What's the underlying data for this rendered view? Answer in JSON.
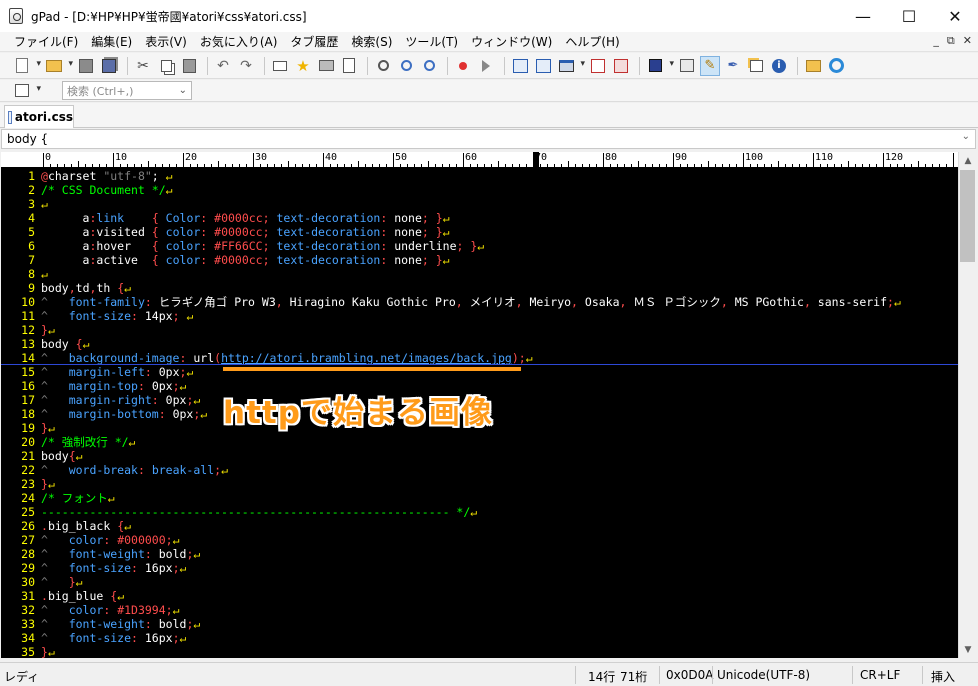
{
  "window": {
    "title": "gPad - [D:¥HP¥HP¥蛍帝國¥atori¥css¥atori.css]",
    "controls": [
      "—",
      "☐",
      "✕"
    ]
  },
  "menu": {
    "items": [
      "ファイル(F)",
      "編集(E)",
      "表示(V)",
      "お気に入り(A)",
      "タブ履歴",
      "検索(S)",
      "ツール(T)",
      "ウィンドウ(W)",
      "ヘルプ(H)"
    ],
    "mdi_controls": [
      "_",
      "⧉",
      "✕"
    ]
  },
  "toolbar": {
    "icons": [
      "new-file-icon",
      "open-folder-icon",
      "save-icon",
      "save-all-icon",
      "cut-icon",
      "copy-icon",
      "paste-icon",
      "undo-icon",
      "redo-icon",
      "folder-icon",
      "favorite-star-icon",
      "print-icon",
      "page-icon",
      "find-icon",
      "find-next-icon",
      "find-prev-icon",
      "record-macro-icon",
      "play-macro-icon",
      "ruler-icon",
      "grid-icon",
      "window-icon",
      "list-icon",
      "list-red-icon",
      "color-icon",
      "config-icon",
      "edit-pen-icon",
      "pin-icon",
      "new-window-icon",
      "info-icon",
      "folder-open-icon",
      "browser-icon"
    ]
  },
  "search": {
    "placeholder": "検索 (Ctrl+,)"
  },
  "tab": {
    "label": "atori.css"
  },
  "function_bar": {
    "value": "body {"
  },
  "ruler": {
    "labels": [
      "0",
      "10",
      "20",
      "30",
      "40",
      "50",
      "60",
      "70",
      "80",
      "90",
      "100",
      "110",
      "120"
    ]
  },
  "editor": {
    "current_line": 14,
    "lines": [
      [
        [
          "c-at",
          "@"
        ],
        [
          "",
          "charset "
        ],
        [
          "c-str",
          "\"utf-8\""
        ],
        [
          "",
          "; "
        ],
        [
          "c-eol",
          "↵"
        ]
      ],
      [
        [
          "c-cmt",
          "/* CSS Document */"
        ],
        [
          "c-eol",
          "↵"
        ]
      ],
      [
        [
          "c-eol",
          "↵"
        ]
      ],
      [
        [
          "",
          "      a"
        ],
        [
          "c-red",
          ":"
        ],
        [
          "c-prop",
          "link"
        ],
        [
          "",
          "    "
        ],
        [
          "c-red",
          "{ "
        ],
        [
          "c-prop",
          "Color"
        ],
        [
          "c-red",
          ": "
        ],
        [
          "c-red",
          "#0000cc"
        ],
        [
          "c-red",
          "; "
        ],
        [
          "c-prop",
          "text-decoration"
        ],
        [
          "c-red",
          ": "
        ],
        [
          "",
          "none"
        ],
        [
          "c-red",
          "; }"
        ],
        [
          "c-eol",
          "↵"
        ]
      ],
      [
        [
          "",
          "      a"
        ],
        [
          "c-red",
          ":"
        ],
        [
          "",
          "visited "
        ],
        [
          "c-red",
          "{ "
        ],
        [
          "c-prop",
          "color"
        ],
        [
          "c-red",
          ": "
        ],
        [
          "c-red",
          "#0000cc"
        ],
        [
          "c-red",
          "; "
        ],
        [
          "c-prop",
          "text-decoration"
        ],
        [
          "c-red",
          ": "
        ],
        [
          "",
          "none"
        ],
        [
          "c-red",
          "; }"
        ],
        [
          "c-eol",
          "↵"
        ]
      ],
      [
        [
          "",
          "      a"
        ],
        [
          "c-red",
          ":"
        ],
        [
          "",
          "hover   "
        ],
        [
          "c-red",
          "{ "
        ],
        [
          "c-prop",
          "color"
        ],
        [
          "c-red",
          ": "
        ],
        [
          "c-red",
          "#FF66CC"
        ],
        [
          "c-red",
          "; "
        ],
        [
          "c-prop",
          "text-decoration"
        ],
        [
          "c-red",
          ": "
        ],
        [
          "",
          "underline"
        ],
        [
          "c-red",
          "; }"
        ],
        [
          "c-eol",
          "↵"
        ]
      ],
      [
        [
          "",
          "      a"
        ],
        [
          "c-red",
          ":"
        ],
        [
          "",
          "active  "
        ],
        [
          "c-red",
          "{ "
        ],
        [
          "c-prop",
          "color"
        ],
        [
          "c-red",
          ": "
        ],
        [
          "c-red",
          "#0000cc"
        ],
        [
          "c-red",
          "; "
        ],
        [
          "c-prop",
          "text-decoration"
        ],
        [
          "c-red",
          ": "
        ],
        [
          "",
          "none"
        ],
        [
          "c-red",
          "; }"
        ],
        [
          "c-eol",
          "↵"
        ]
      ],
      [
        [
          "c-eol",
          "↵"
        ]
      ],
      [
        [
          "",
          "body"
        ],
        [
          "c-red",
          ","
        ],
        [
          "",
          "td"
        ],
        [
          "c-red",
          ","
        ],
        [
          "",
          "th "
        ],
        [
          "c-red",
          "{"
        ],
        [
          "c-eol",
          "↵"
        ]
      ],
      [
        [
          "c-tab",
          "^   "
        ],
        [
          "c-prop",
          "font-family"
        ],
        [
          "c-red",
          ": "
        ],
        [
          "",
          "ヒラギノ角ゴ Pro W3"
        ],
        [
          "c-red",
          ", "
        ],
        [
          "",
          "Hiragino Kaku Gothic Pro"
        ],
        [
          "c-red",
          ", "
        ],
        [
          "",
          "メイリオ"
        ],
        [
          "c-red",
          ", "
        ],
        [
          "",
          "Meiryo"
        ],
        [
          "c-red",
          ", "
        ],
        [
          "",
          "Osaka"
        ],
        [
          "c-red",
          ", "
        ],
        [
          "",
          "ＭＳ Ｐゴシック"
        ],
        [
          "c-red",
          ", "
        ],
        [
          "",
          "MS PGothic"
        ],
        [
          "c-red",
          ", "
        ],
        [
          "",
          "sans-serif"
        ],
        [
          "c-red",
          ";"
        ],
        [
          "c-eol",
          "↵"
        ]
      ],
      [
        [
          "c-tab",
          "^   "
        ],
        [
          "c-prop",
          "font-size"
        ],
        [
          "c-red",
          ": "
        ],
        [
          "",
          "14px"
        ],
        [
          "c-red",
          "; "
        ],
        [
          "c-eol",
          "↵"
        ]
      ],
      [
        [
          "c-red",
          "}"
        ],
        [
          "c-eol",
          "↵"
        ]
      ],
      [
        [
          "",
          "body "
        ],
        [
          "c-red",
          "{"
        ],
        [
          "c-eol",
          "↵"
        ]
      ],
      [
        [
          "c-tab",
          "^   "
        ],
        [
          "c-prop",
          "background-image"
        ],
        [
          "c-red",
          ": "
        ],
        [
          "",
          "url"
        ],
        [
          "c-red",
          "("
        ],
        [
          "c-url",
          "http://atori.brambling.net/images/back.jpg"
        ],
        [
          "c-red",
          ");"
        ],
        [
          "c-eol",
          "↵"
        ]
      ],
      [
        [
          "c-tab",
          "^   "
        ],
        [
          "c-prop",
          "margin-left"
        ],
        [
          "c-red",
          ": "
        ],
        [
          "",
          "0px"
        ],
        [
          "c-red",
          ";"
        ],
        [
          "c-eol",
          "↵"
        ]
      ],
      [
        [
          "c-tab",
          "^   "
        ],
        [
          "c-prop",
          "margin-top"
        ],
        [
          "c-red",
          ": "
        ],
        [
          "",
          "0px"
        ],
        [
          "c-red",
          ";"
        ],
        [
          "c-eol",
          "↵"
        ]
      ],
      [
        [
          "c-tab",
          "^   "
        ],
        [
          "c-prop",
          "margin-right"
        ],
        [
          "c-red",
          ": "
        ],
        [
          "",
          "0px"
        ],
        [
          "c-red",
          ";"
        ],
        [
          "c-eol",
          "↵"
        ]
      ],
      [
        [
          "c-tab",
          "^   "
        ],
        [
          "c-prop",
          "margin-bottom"
        ],
        [
          "c-red",
          ": "
        ],
        [
          "",
          "0px"
        ],
        [
          "c-red",
          ";"
        ],
        [
          "c-eol",
          "↵"
        ]
      ],
      [
        [
          "c-red",
          "}"
        ],
        [
          "c-eol",
          "↵"
        ]
      ],
      [
        [
          "c-cmt",
          "/* 強制改行 */"
        ],
        [
          "c-eol",
          "↵"
        ]
      ],
      [
        [
          "",
          "body"
        ],
        [
          "c-red",
          "{"
        ],
        [
          "c-eol",
          "↵"
        ]
      ],
      [
        [
          "c-tab",
          "^   "
        ],
        [
          "c-prop",
          "word-break"
        ],
        [
          "c-red",
          ": "
        ],
        [
          "c-prop",
          "break-all"
        ],
        [
          "c-red",
          ";"
        ],
        [
          "c-eol",
          "↵"
        ]
      ],
      [
        [
          "c-red",
          "}"
        ],
        [
          "c-eol",
          "↵"
        ]
      ],
      [
        [
          "c-cmt",
          "/* フォント"
        ],
        [
          "c-eol",
          "↵"
        ]
      ],
      [
        [
          "c-cmt",
          "----------------------------------------------------------- */"
        ],
        [
          "c-eol",
          "↵"
        ]
      ],
      [
        [
          "c-red",
          "."
        ],
        [
          "",
          "big_black "
        ],
        [
          "c-red",
          "{"
        ],
        [
          "c-eol",
          "↵"
        ]
      ],
      [
        [
          "c-tab",
          "^   "
        ],
        [
          "c-prop",
          "color"
        ],
        [
          "c-red",
          ": "
        ],
        [
          "c-red",
          "#000000"
        ],
        [
          "c-red",
          ";"
        ],
        [
          "c-eol",
          "↵"
        ]
      ],
      [
        [
          "c-tab",
          "^   "
        ],
        [
          "c-prop",
          "font-weight"
        ],
        [
          "c-red",
          ": "
        ],
        [
          "",
          "bold"
        ],
        [
          "c-red",
          ";"
        ],
        [
          "c-eol",
          "↵"
        ]
      ],
      [
        [
          "c-tab",
          "^   "
        ],
        [
          "c-prop",
          "font-size"
        ],
        [
          "c-red",
          ": "
        ],
        [
          "",
          "16px"
        ],
        [
          "c-red",
          ";"
        ],
        [
          "c-eol",
          "↵"
        ]
      ],
      [
        [
          "c-tab",
          "^   "
        ],
        [
          "c-red",
          "}"
        ],
        [
          "c-eol",
          "↵"
        ]
      ],
      [
        [
          "c-red",
          "."
        ],
        [
          "",
          "big_blue "
        ],
        [
          "c-red",
          "{"
        ],
        [
          "c-eol",
          "↵"
        ]
      ],
      [
        [
          "c-tab",
          "^   "
        ],
        [
          "c-prop",
          "color"
        ],
        [
          "c-red",
          ": "
        ],
        [
          "c-red",
          "#1D3994"
        ],
        [
          "c-red",
          ";"
        ],
        [
          "c-eol",
          "↵"
        ]
      ],
      [
        [
          "c-tab",
          "^   "
        ],
        [
          "c-prop",
          "font-weight"
        ],
        [
          "c-red",
          ": "
        ],
        [
          "",
          "bold"
        ],
        [
          "c-red",
          ";"
        ],
        [
          "c-eol",
          "↵"
        ]
      ],
      [
        [
          "c-tab",
          "^   "
        ],
        [
          "c-prop",
          "font-size"
        ],
        [
          "c-red",
          ": "
        ],
        [
          "",
          "16px"
        ],
        [
          "c-red",
          ";"
        ],
        [
          "c-eol",
          "↵"
        ]
      ],
      [
        [
          "c-red",
          "}"
        ],
        [
          "c-eol",
          "↵"
        ]
      ]
    ]
  },
  "annotation": {
    "text": "httpで始まる画像"
  },
  "status": {
    "mode": "レディ",
    "line": "14行",
    "col": "71桁",
    "char_code": "0x0D0A",
    "encoding": "Unicode(UTF-8)",
    "newline": "CR+LF",
    "insert": "挿入"
  }
}
